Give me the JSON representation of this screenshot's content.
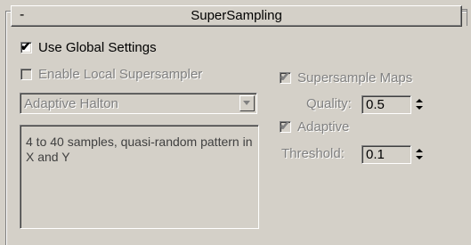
{
  "rollout": {
    "collapse_symbol": "-",
    "title": "SuperSampling"
  },
  "options": {
    "use_global_settings": {
      "label": "Use Global Settings",
      "checked": true,
      "enabled": true
    },
    "enable_local_supersampler": {
      "label": "Enable Local Supersampler",
      "checked": false,
      "enabled": false
    },
    "supersample_maps": {
      "label": "Supersample Maps",
      "checked": true,
      "enabled": false
    },
    "adaptive": {
      "label": "Adaptive",
      "checked": true,
      "enabled": false
    }
  },
  "sampler": {
    "selected": "Adaptive Halton",
    "description": "4 to 40 samples, quasi-random pattern in X and Y"
  },
  "quality": {
    "label": "Quality:",
    "value": "0.5"
  },
  "threshold": {
    "label": "Threshold:",
    "value": "0.1"
  },
  "icons": {
    "tick": "✔",
    "dropdown": "chevron-down-icon",
    "spinner": "spinner-arrows-icon"
  },
  "colors": {
    "panel_bg": "#d4d0c8",
    "disabled_text": "#808080"
  }
}
